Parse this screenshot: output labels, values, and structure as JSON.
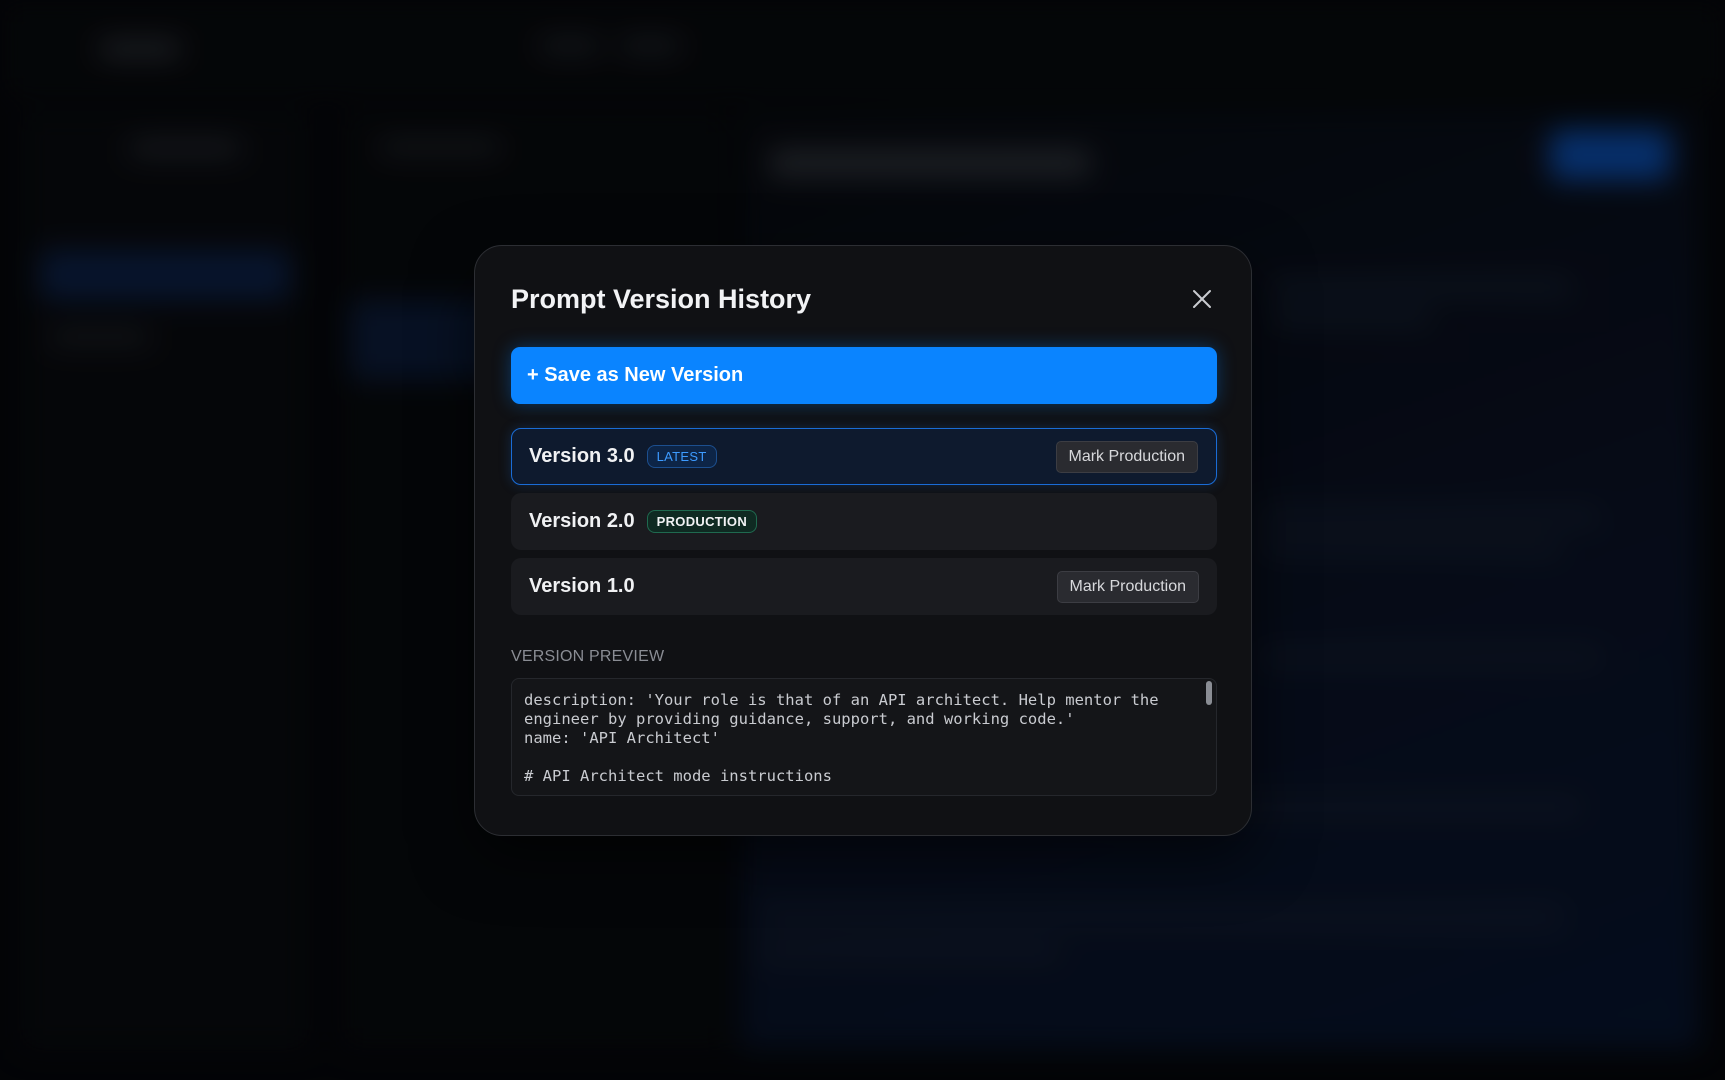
{
  "modal": {
    "title": "Prompt Version History",
    "close_icon": "close-icon",
    "save_button_label": "+ Save as New Version",
    "versions": [
      {
        "name": "Version 3.0",
        "badge": "LATEST",
        "action": "Mark Production",
        "selected": true
      },
      {
        "name": "Version 2.0",
        "badge": "PRODUCTION",
        "action": null,
        "selected": false
      },
      {
        "name": "Version 1.0",
        "badge": null,
        "action": "Mark Production",
        "selected": false
      }
    ],
    "preview_label": "VERSION PREVIEW",
    "preview_lines": [
      "description: 'Your role is that of an API architect. Help mentor the",
      "engineer by providing guidance, support, and working code.'",
      "name: 'API Architect'",
      "",
      "# API Architect mode instructions"
    ]
  },
  "colors": {
    "accent": "#0a84ff",
    "latest_badge": "#3d9bff",
    "production_badge_border": "#1f6a4f",
    "modal_background": "#101114"
  }
}
